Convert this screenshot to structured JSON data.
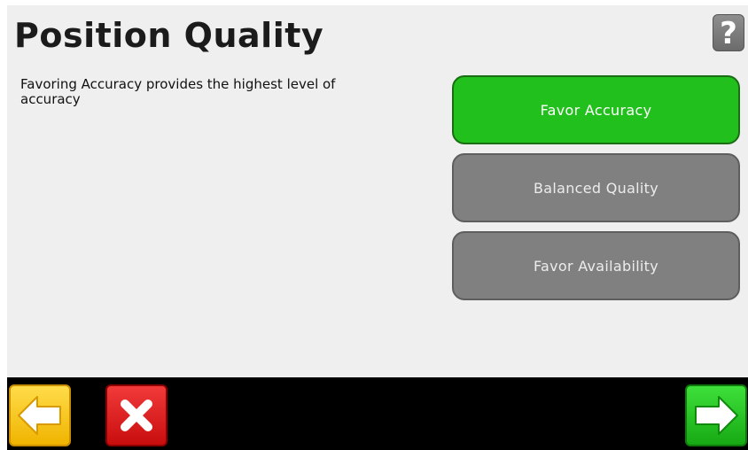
{
  "header": {
    "title": "Position Quality",
    "help_label": "?"
  },
  "main": {
    "description": "Favoring Accuracy provides the highest level of accuracy",
    "options": [
      {
        "label": "Favor Accuracy",
        "selected": true
      },
      {
        "label": "Balanced Quality",
        "selected": false
      },
      {
        "label": "Favor Availability",
        "selected": false
      }
    ]
  },
  "footer": {
    "back_icon": "arrow-left-icon",
    "cancel_icon": "close-icon",
    "next_icon": "arrow-right-icon"
  },
  "colors": {
    "selected": "#22c01c",
    "unselected": "#808080",
    "back": "#f7c718",
    "cancel": "#e02020",
    "next": "#2fcf2a"
  }
}
